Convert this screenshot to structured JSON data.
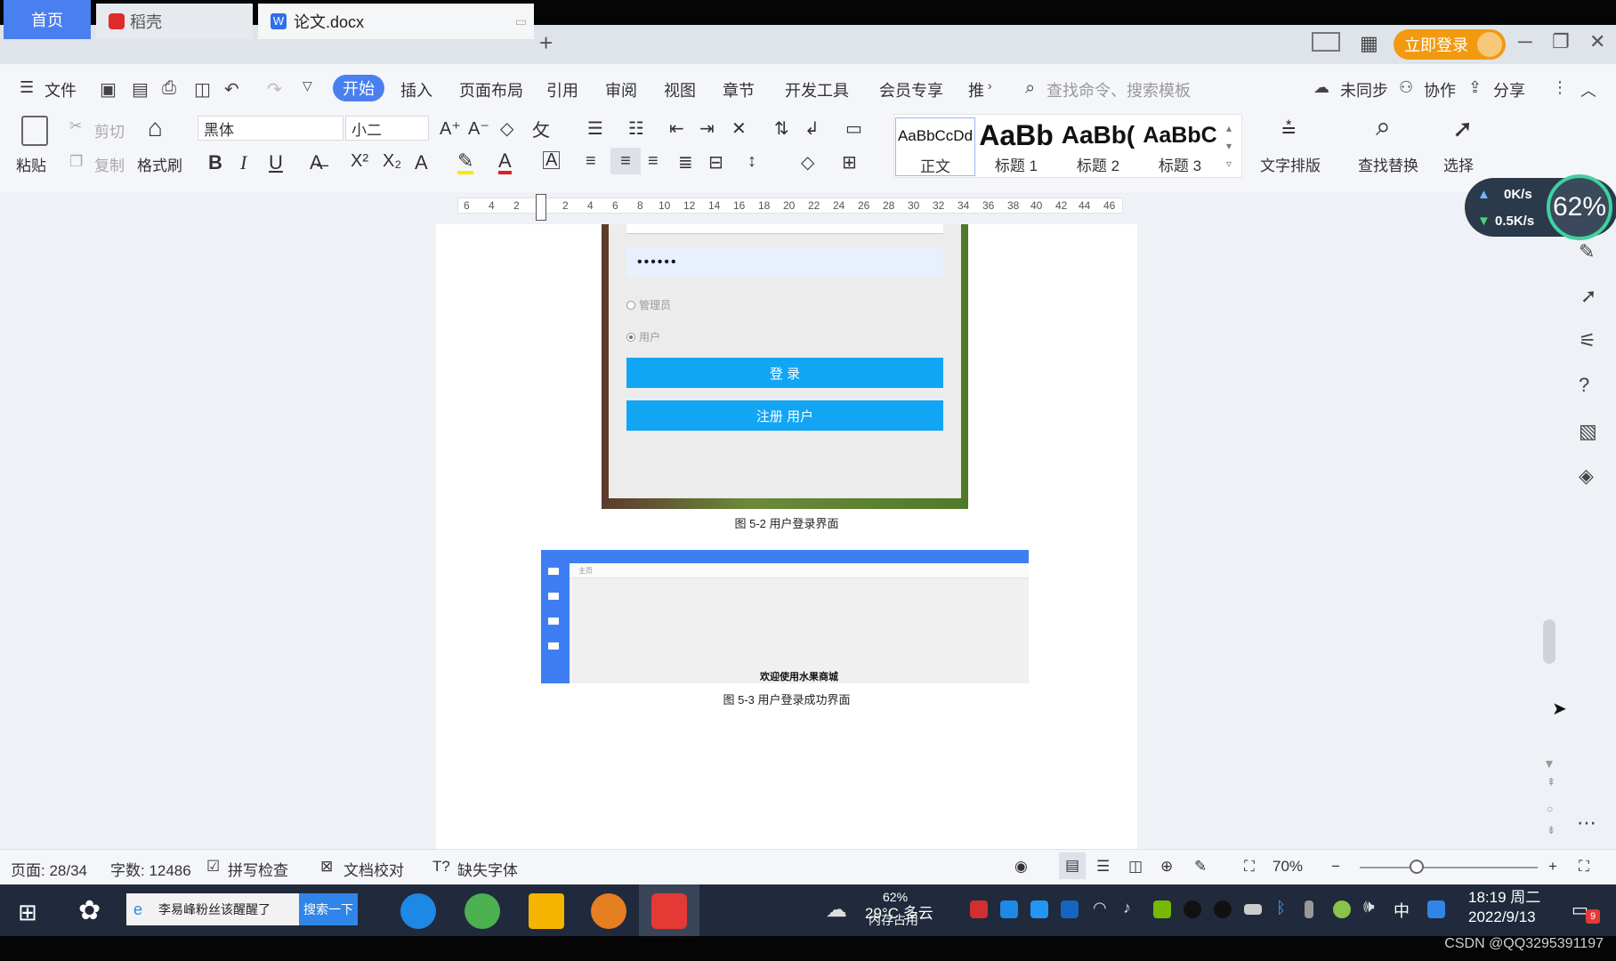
{
  "tabs": {
    "home": "首页",
    "daoke": "稻壳",
    "doc": "论文.docx",
    "add": "+"
  },
  "window": {
    "login": "立即登录",
    "min": "─",
    "restore": "❐",
    "close": "✕"
  },
  "menu": {
    "file": "文件",
    "items": [
      "开始",
      "插入",
      "页面布局",
      "引用",
      "审阅",
      "视图",
      "章节",
      "开发工具",
      "会员专享",
      "推"
    ],
    "search_placeholder": "查找命令、搜索模板",
    "unsynced": "未同步",
    "collab": "协作",
    "share": "分享"
  },
  "ribbon": {
    "paste": "粘贴",
    "cut": "剪切",
    "copy": "复制",
    "format_painter": "格式刷",
    "font": "黑体",
    "size": "小二",
    "styles": [
      {
        "preview": "AaBbCcDd",
        "name": "正文"
      },
      {
        "preview": "AaBb",
        "name": "标题 1"
      },
      {
        "preview": "AaBb(",
        "name": "标题 2"
      },
      {
        "preview": "AaBbC",
        "name": "标题 3"
      }
    ],
    "text_layout": "文字排版",
    "find_replace": "查找替换",
    "select": "选择"
  },
  "ruler_ticks": [
    "6",
    "4",
    "2",
    "2",
    "4",
    "6",
    "8",
    "10",
    "12",
    "14",
    "16",
    "18",
    "20",
    "22",
    "24",
    "26",
    "28",
    "30",
    "32",
    "34",
    "36",
    "38",
    "40",
    "42",
    "44",
    "46"
  ],
  "net": {
    "up": "0K/s",
    "down": "0.5K/s",
    "percent": "62%"
  },
  "document": {
    "password_mask": "••••••",
    "radio_admin": "管理员",
    "radio_user": "用户",
    "login_button": "登 录",
    "register_button": "注册 用户",
    "caption1": "图 5-2 用户登录界面",
    "shot2_tab": "主页",
    "welcome": "欢迎使用水果商城",
    "caption2": "图 5-3 用户登录成功界面"
  },
  "status": {
    "page": "页面: 28/34",
    "words": "字数: 12486",
    "spell": "拼写检查",
    "proof": "文档校对",
    "missing_font": "缺失字体",
    "zoom": "70%"
  },
  "taskbar": {
    "search_text": "李易峰粉丝该醒醒了",
    "search_button": "搜索一下",
    "weather": "29°C 多云",
    "mem_percent": "62%",
    "mem_label": "内存占用",
    "ime": "中",
    "time": "18:19 周二",
    "date": "2022/9/13",
    "notif_count": "9"
  },
  "watermark": "CSDN @QQ3295391197",
  "colors": {
    "accent": "#4a7ff0",
    "login": "#f19a10",
    "doc_button": "#12a5f4",
    "taskbar": "#202a3c"
  }
}
